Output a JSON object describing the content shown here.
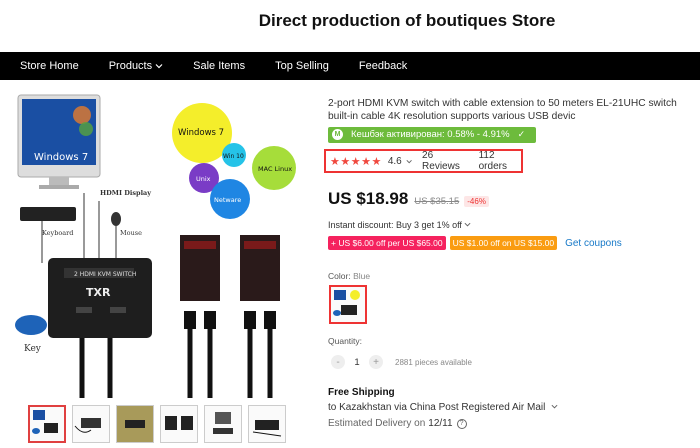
{
  "store": {
    "title": "Direct production of boutiques Store"
  },
  "nav": {
    "items": [
      {
        "label": "Store Home"
      },
      {
        "label": "Products"
      },
      {
        "label": "Sale Items"
      },
      {
        "label": "Top Selling"
      },
      {
        "label": "Feedback"
      }
    ]
  },
  "gallery": {
    "labels": {
      "windows7_monitor": "Windows 7",
      "keyboard": "Keyboard",
      "hdmi_display": "HDMI Display",
      "mouse": "Mouse",
      "key": "Key",
      "device_top": "2 HDMI KVM SWITCH",
      "device_txr": "TXR",
      "bubble_windows7": "Windows 7",
      "bubble_win10": "Win 10",
      "bubble_mac": "MAC Linux",
      "bubble_unix": "Unix",
      "bubble_netware": "Netware"
    },
    "thumb_count": 6
  },
  "product": {
    "title": "2-port HDMI KVM switch with cable extension to 50 meters EL-21UHC switch built-in cable 4K resolution supports various USB devic",
    "cashback": {
      "icon": "M",
      "text": "Кешбэк активирован: 0.58% - 4.91%",
      "check": "✓"
    },
    "rating": {
      "stars": "★★★★★",
      "value": "4.6",
      "reviews": "26 Reviews",
      "orders": "112 orders"
    },
    "price": {
      "current": "US $18.98",
      "old": "US $35.15",
      "discount": "-46%"
    },
    "instant_discount": "Instant discount: Buy 3 get 1% off",
    "coupons": [
      {
        "text": "+ US $6.00 off per US $65.00",
        "color": "#f5225e"
      },
      {
        "text": "US $1.00 off on US $15.00",
        "color": "#fa9c11"
      }
    ],
    "get_coupons": "Get coupons",
    "color": {
      "label": "Color:",
      "value": "Blue"
    },
    "quantity": {
      "label": "Quantity:",
      "minus": "-",
      "plus": "+",
      "value": "1",
      "available": "2881 pieces available"
    },
    "shipping": {
      "title": "Free Shipping",
      "to": "to Kazakhstan via China Post Registered Air Mail",
      "delivery_label": "Estimated Delivery on",
      "delivery_date": "12/11",
      "help": "?"
    }
  },
  "colors": {
    "accent_red": "#e33333",
    "cashback_green": "#6dbb3c",
    "link_blue": "#1779c8"
  }
}
